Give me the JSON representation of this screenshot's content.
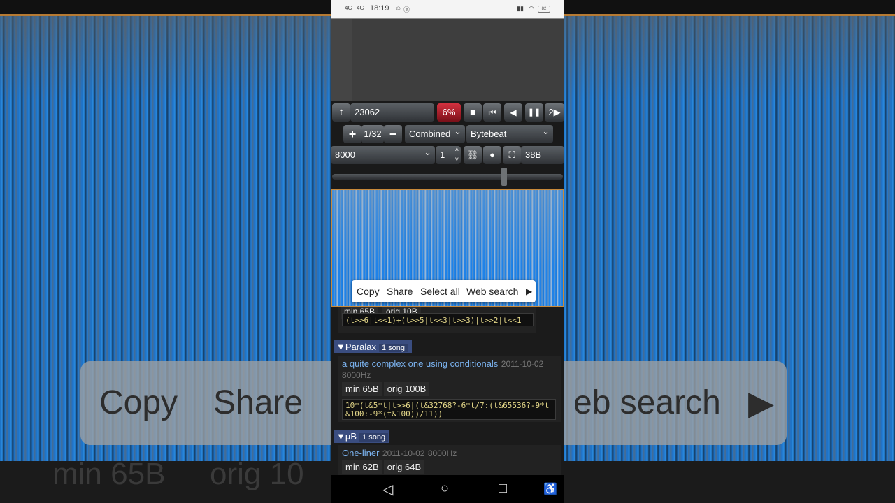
{
  "background": {
    "popup_copy": "Copy",
    "popup_share": "Share",
    "popup_web_search": "eb search",
    "bottom_min": "min 65B",
    "bottom_orig": "orig 10"
  },
  "status_bar": {
    "signal1": "4G",
    "signal2": "4G",
    "time": "18:19",
    "battery": "82"
  },
  "controls": {
    "time_label": "t",
    "time_value": "23062",
    "volume": "6%",
    "stop_icon": "■",
    "rewind_start_icon": "⏮",
    "rewind_icon": "◀",
    "pause_icon": "❚❚",
    "speed_value": "2",
    "add_icon": "+",
    "scale": "1/32",
    "minus_icon": "−",
    "mode_select": "Combined",
    "type_select": "Bytebeat",
    "sample_rate": "8000",
    "stepper_value": "1",
    "link_icon": "⛓",
    "record_icon": "●",
    "fullscreen_icon": "⛶",
    "code_size": "38B"
  },
  "context_menu": {
    "items": [
      "Copy",
      "Share",
      "Select all",
      "Web search"
    ],
    "more_icon": "▶"
  },
  "library": {
    "partial_entry": {
      "min": "min 65B",
      "orig": "orig 10B",
      "code": "(t>>6|t<<1)+(t>>5|t<<3|t>>3)|t>>2|t<<1"
    },
    "groups": [
      {
        "name": "▼Paralax",
        "count": "1 song",
        "entry": {
          "title": "a quite complex one using conditionals",
          "date": "2011-10-02",
          "rate": "8000Hz",
          "min": "min 65B",
          "orig": "orig 100B",
          "code": "10*(t&5*t|t>>6|(t&32768?-6*t/7:(t&65536?-9*t&100:-9*(t&100))/11))"
        }
      },
      {
        "name": "▼µB",
        "count": "1 song",
        "entry": {
          "title": "One-liner",
          "date": "2011-10-02",
          "rate": "8000Hz",
          "min": "min 62B",
          "orig": "orig 64B"
        }
      }
    ]
  },
  "nav_bar": {
    "back_icon": "◁",
    "home_icon": "○",
    "recents_icon": "□",
    "accessibility_icon": "♿"
  }
}
